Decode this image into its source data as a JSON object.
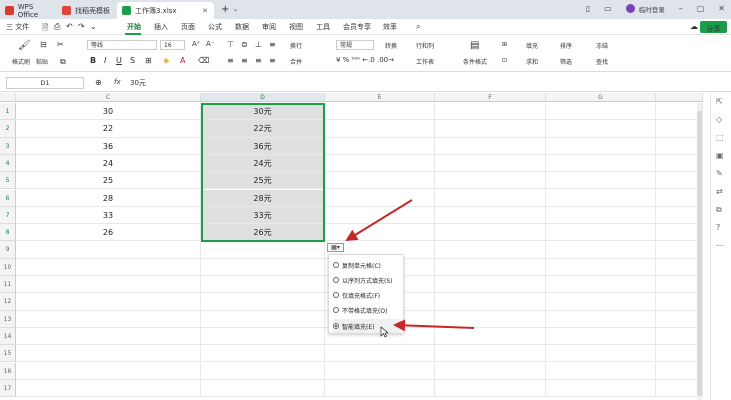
{
  "tabs": [
    {
      "label": "WPS Office"
    },
    {
      "label": "找稻壳模板"
    },
    {
      "label": "工作簿3.xlsx"
    }
  ],
  "window": {
    "new_tab": "+",
    "user": "临时登录",
    "share": "分享"
  },
  "menu": {
    "file": "三 文件",
    "items": [
      "开始",
      "插入",
      "页面",
      "公式",
      "数据",
      "审阅",
      "视图",
      "工具",
      "会员专享",
      "效率"
    ]
  },
  "ribbon": {
    "format_painter": "格式刷",
    "paste": "粘贴",
    "font": "等线",
    "font_size": "16",
    "wrap": "换行",
    "merge": "合并",
    "number_format": "常规",
    "convert": "转换",
    "row_col": "行和列",
    "sheet": "工作表",
    "cond_format": "条件格式",
    "fill": "填充",
    "sum": "求和",
    "sort": "排序",
    "filter": "筛选",
    "freeze": "冻结",
    "find": "查找"
  },
  "formula": {
    "cell_ref": "D1",
    "fx": "fx",
    "value": "30元"
  },
  "columns": [
    "C",
    "D",
    "E",
    "F",
    "G"
  ],
  "rows": [
    "1",
    "2",
    "3",
    "4",
    "5",
    "6",
    "7",
    "8",
    "9",
    "10",
    "11",
    "12",
    "13",
    "14",
    "15",
    "16",
    "17"
  ],
  "col_c": [
    "30",
    "22",
    "36",
    "24",
    "25",
    "28",
    "33",
    "26"
  ],
  "col_d": [
    "30元",
    "22元",
    "36元",
    "24元",
    "25元",
    "28元",
    "33元",
    "26元"
  ],
  "autofill_options": [
    {
      "label": "复制单元格(C)",
      "selected": false
    },
    {
      "label": "以序列方式填充(S)",
      "selected": false
    },
    {
      "label": "仅填充格式(F)",
      "selected": false
    },
    {
      "label": "不带格式填充(O)",
      "selected": false
    },
    {
      "label": "智能填充(E)",
      "selected": true
    }
  ],
  "colors": {
    "accent": "#1a9e4a",
    "arrow": "#c62828",
    "tab_bg": "#dfe3ea"
  }
}
